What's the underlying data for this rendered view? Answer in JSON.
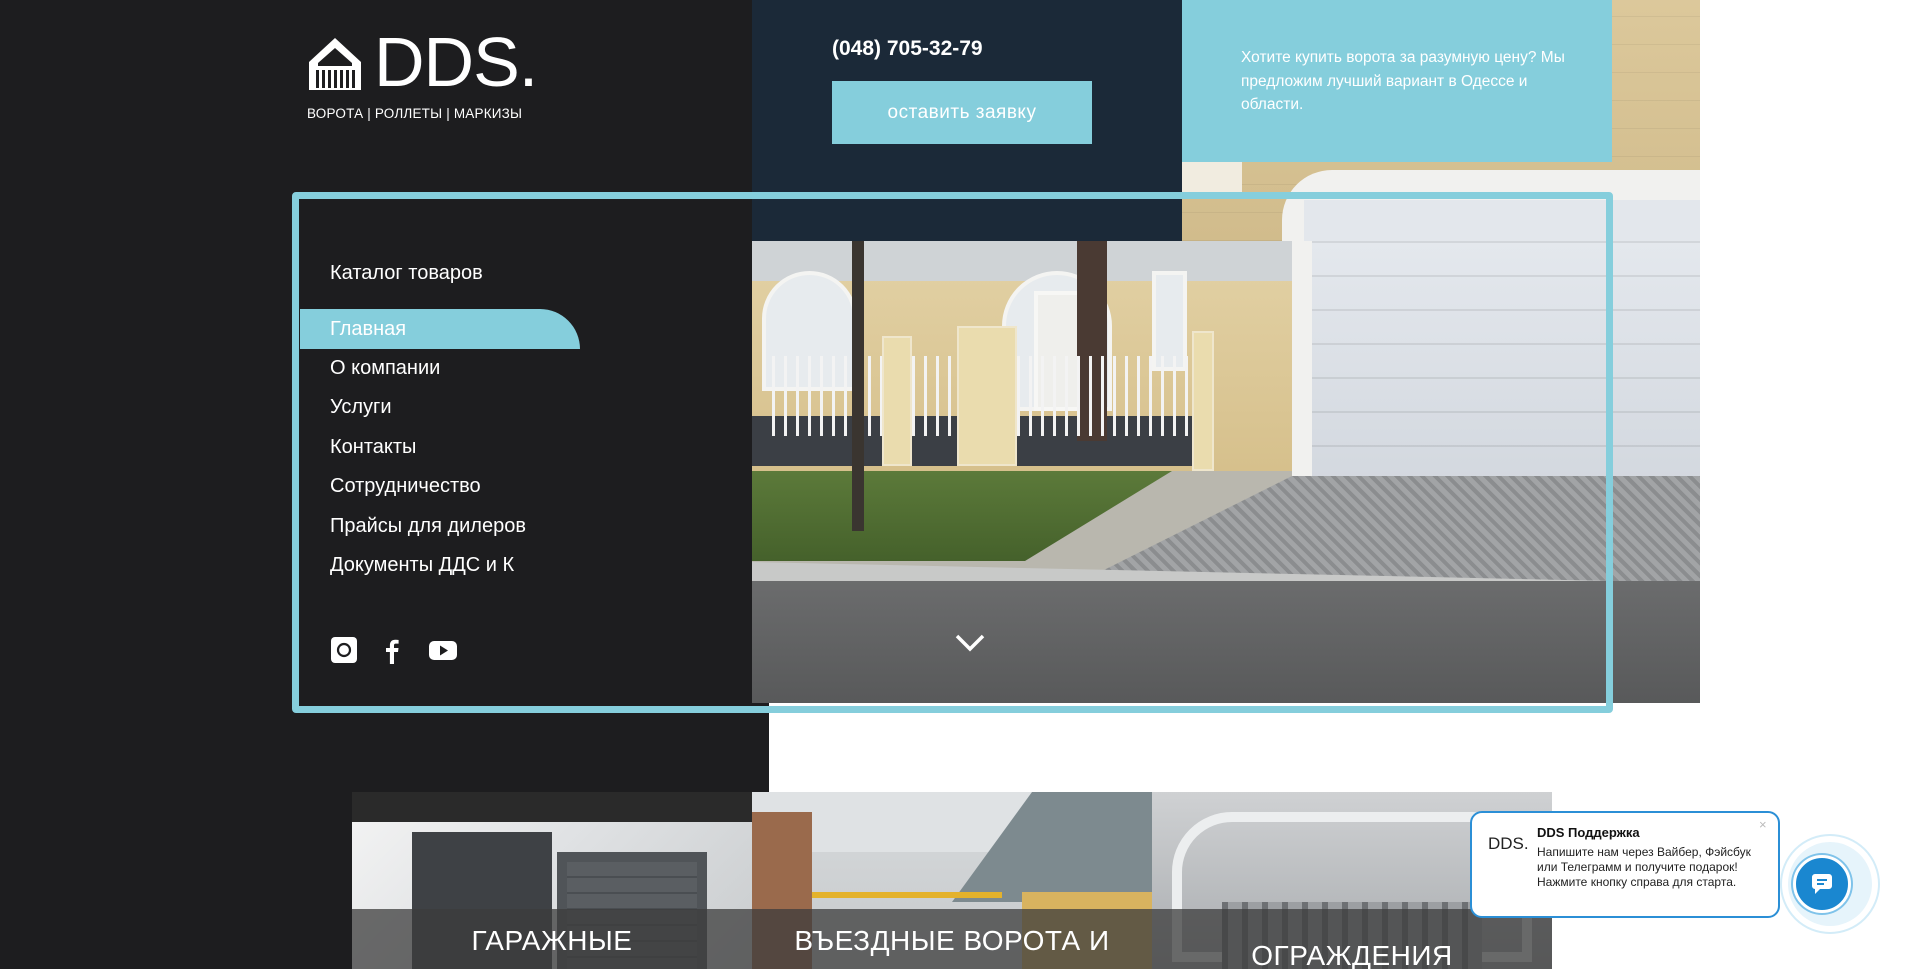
{
  "header": {
    "logo_text": "DDS.",
    "logo_tagline": "ВОРОТА | РОЛЛЕТЫ | МАРКИЗЫ",
    "phone": "(048) 705-32-79",
    "cta_label": "оставить заявку",
    "promo_text": "Хотите купить ворота за разумную цену? Мы предложим лучший вариант в Одессе и области."
  },
  "menu": {
    "title": "Каталог товаров",
    "items": [
      {
        "label": "Главная",
        "active": true
      },
      {
        "label": "О компании"
      },
      {
        "label": "Услуги"
      },
      {
        "label": "Контакты"
      },
      {
        "label": "Сотрудничество"
      },
      {
        "label": "Прайсы для дилеров"
      },
      {
        "label": "Документы ДДС и К"
      }
    ]
  },
  "social": [
    {
      "icon": "instagram-icon"
    },
    {
      "icon": "facebook-icon"
    },
    {
      "icon": "youtube-icon"
    }
  ],
  "categories": [
    {
      "label": "ГАРАЖНЫЕ"
    },
    {
      "label": "ВЪЕЗДНЫЕ ВОРОТА И"
    },
    {
      "label": "ОГРАЖДЕНИЯ"
    }
  ],
  "chat": {
    "logo": "DDS.",
    "title": "DDS Поддержка",
    "body": "Напишите нам через Вайбер, Фэйсбук или Телеграмм и получите подарок! Нажмите кнопку справа для старта.",
    "close": "×"
  },
  "colors": {
    "accent": "#85cedc",
    "dark": "#1d1d1f",
    "navy": "#1b2938",
    "chat_blue": "#1a87d0"
  }
}
